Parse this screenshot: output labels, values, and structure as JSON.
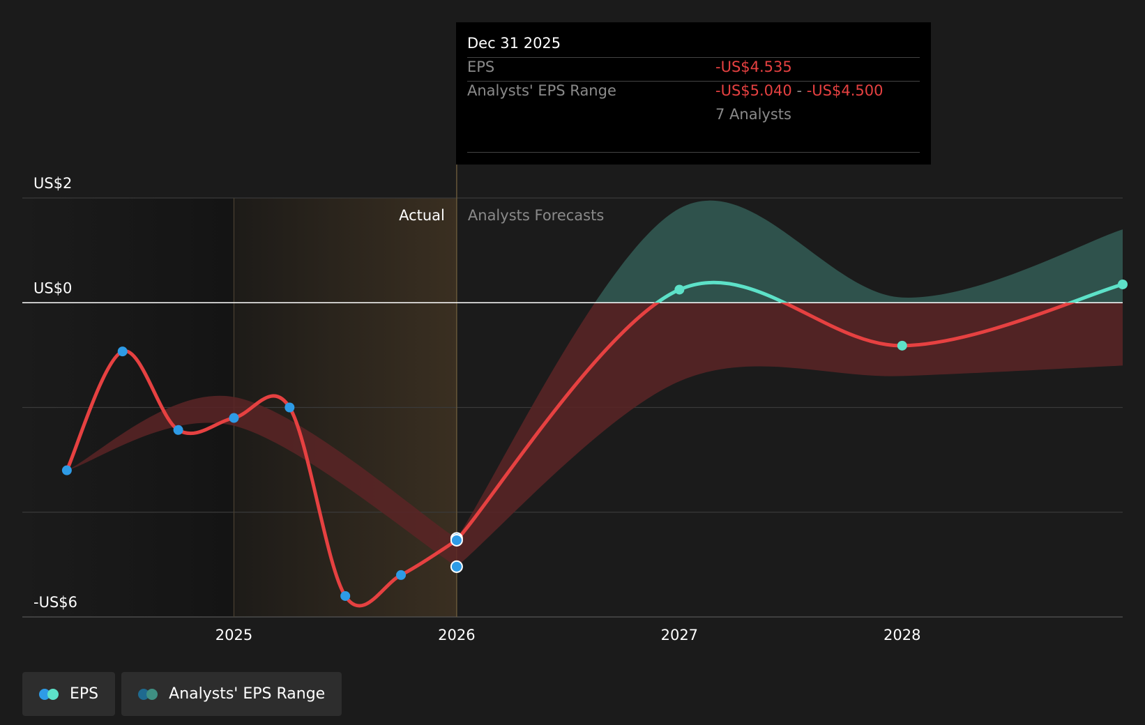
{
  "colors": {
    "background": "#1b1b1b",
    "eps_line": "#e64141",
    "eps_dot_actual": "#2e9be6",
    "eps_dot_forecast": "#5de1c8",
    "range_negative_fill": "#5a2426",
    "range_positive_fill": "#2f524c",
    "actual_band": "#3a2f21",
    "grid": "#3a3a3a",
    "zero_line": "#ffffff"
  },
  "tooltip": {
    "date": "Dec 31 2025",
    "eps_label": "EPS",
    "eps_value": "-US$4.535",
    "range_label": "Analysts' EPS Range",
    "range_low": "-US$5.040",
    "range_sep": "-",
    "range_high": "-US$4.500",
    "analysts": "7 Analysts"
  },
  "legend": [
    {
      "label": "EPS",
      "dot1": "#2e9be6",
      "dot2": "#5de1c8"
    },
    {
      "label": "Analysts' EPS Range",
      "dot1": "#1f6a8f",
      "dot2": "#3f8f82"
    }
  ],
  "chart_data": {
    "type": "line",
    "title": "",
    "section_labels": {
      "actual": "Actual",
      "forecast": "Analysts Forecasts"
    },
    "y_tick_labels": [
      {
        "value": 2,
        "label": "US$2"
      },
      {
        "value": 0,
        "label": "US$0"
      },
      {
        "value": -6,
        "label": "-US$6"
      }
    ],
    "ylim": [
      -6,
      2
    ],
    "y_gridlines": [
      2,
      0,
      -2,
      -4,
      -6
    ],
    "x_tick_labels": [
      {
        "year": 2025,
        "label": "2025"
      },
      {
        "year": 2026,
        "label": "2026"
      },
      {
        "year": 2027,
        "label": "2027"
      },
      {
        "year": 2028,
        "label": "2028"
      }
    ],
    "xlim": [
      2024.05,
      2028.99
    ],
    "actual_band": [
      2025.0,
      2026.0
    ],
    "divider_year": 2026.0,
    "series": [
      {
        "name": "EPS",
        "role": "actual",
        "points": [
          {
            "date": "2024-03-31",
            "year": 2024.25,
            "value": -3.2
          },
          {
            "date": "2024-06-30",
            "year": 2024.5,
            "value": -0.93
          },
          {
            "date": "2024-09-30",
            "year": 2024.75,
            "value": -2.43
          },
          {
            "date": "2024-12-31",
            "year": 2025.0,
            "value": -2.2
          },
          {
            "date": "2025-03-31",
            "year": 2025.25,
            "value": -2.0
          },
          {
            "date": "2025-06-30",
            "year": 2025.5,
            "value": -5.6
          },
          {
            "date": "2025-09-30",
            "year": 2025.75,
            "value": -5.2
          },
          {
            "date": "2025-12-31",
            "year": 2026.0,
            "value": -4.535
          }
        ]
      },
      {
        "name": "EPS",
        "role": "forecast",
        "points": [
          {
            "date": "2025-12-31",
            "year": 2026.0,
            "value": -4.535
          },
          {
            "date": "2026-12-31",
            "year": 2027.0,
            "value": 0.25
          },
          {
            "date": "2027-12-31",
            "year": 2028.0,
            "value": -0.82
          },
          {
            "date": "2028-12-31",
            "year": 2028.99,
            "value": 0.35
          }
        ]
      }
    ],
    "range_band_actual": [
      {
        "year": 2024.25,
        "low": -3.2,
        "high": -3.2
      },
      {
        "year": 2025.0,
        "low": -2.35,
        "high": -1.8
      },
      {
        "year": 2026.0,
        "low": -5.04,
        "high": -4.5
      }
    ],
    "range_band_forecast": [
      {
        "year": 2026.0,
        "low": -5.04,
        "high": -4.5
      },
      {
        "year": 2027.0,
        "low": -1.5,
        "high": 1.8
      },
      {
        "year": 2028.0,
        "low": -1.4,
        "high": 0.1
      },
      {
        "year": 2028.99,
        "low": -1.2,
        "high": 1.4
      }
    ],
    "highlight_points": [
      {
        "year": 2026.0,
        "value": -4.5
      },
      {
        "year": 2026.0,
        "value": -5.04
      }
    ]
  }
}
